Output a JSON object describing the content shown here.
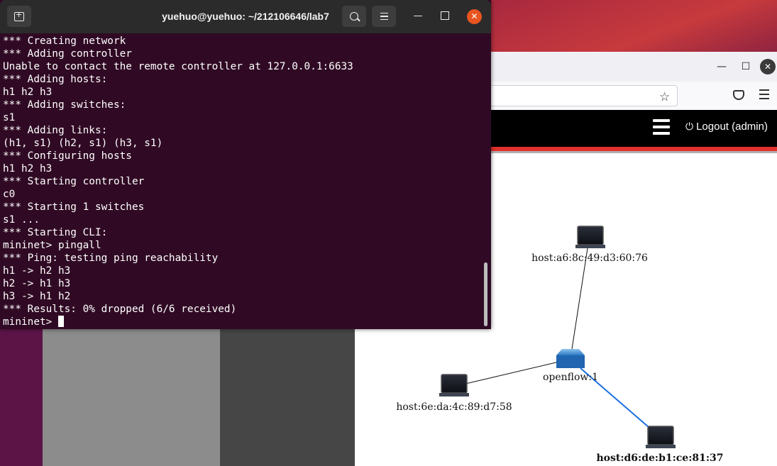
{
  "terminal": {
    "title": "yuehuo@yuehuo: ~/212106646/lab7",
    "lines": [
      "*** Creating network",
      "*** Adding controller",
      "Unable to contact the remote controller at 127.0.0.1:6633",
      "*** Adding hosts:",
      "h1 h2 h3",
      "*** Adding switches:",
      "s1",
      "*** Adding links:",
      "(h1, s1) (h2, s1) (h3, s1)",
      "*** Configuring hosts",
      "h1 h2 h3",
      "*** Starting controller",
      "c0",
      "*** Starting 1 switches",
      "s1 ...",
      "*** Starting CLI:",
      "mininet> pingall",
      "*** Ping: testing ping reachability",
      "h1 -> h2 h3",
      "h2 -> h1 h3",
      "h3 -> h1 h2",
      "*** Results: 0% dropped (6/6 received)"
    ],
    "prompt": "mininet> ",
    "accent_close": "#e95420",
    "background": "#300a24"
  },
  "browser": {
    "app": {
      "logout_label": "Logout (admin)",
      "navbar_color": "#000000",
      "accent": "#e2312c"
    },
    "topology": {
      "hosts": {
        "a6": "host:a6:8c:49:d3:60:76",
        "6e": "host:6e:da:4c:89:d7:58",
        "d6": "host:d6:de:b1:ce:81:37"
      },
      "switch": "openflow:1",
      "highlight_link_color": "#1a6fe0"
    }
  }
}
